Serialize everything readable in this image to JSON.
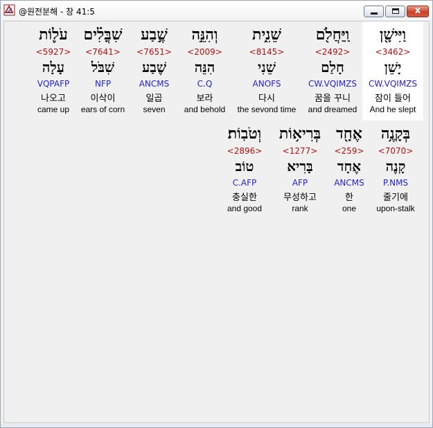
{
  "window": {
    "title": "@원전분해 - 창 41:5",
    "close_glyph": "x"
  },
  "row1": [
    {
      "heb": "וַיִּישָׁ֖ן",
      "strong": "<3462>",
      "lemma": "יָשֵׁן",
      "morph": "CW.VQIMZS",
      "kor": "잠이 들어",
      "eng": "And he slept",
      "highlight": true
    },
    {
      "heb": "וַֽיַּחֲלֹ֖ם",
      "strong": "<2492>",
      "lemma": "חָלַם",
      "morph": "CW.VQIMZS",
      "kor": "꿈을 꾸니",
      "eng": "and dreamed",
      "highlight": false
    },
    {
      "heb": "שֵׁנִ֑ית",
      "strong": "<8145>",
      "lemma": "שֵׁנִי",
      "morph": "ANOFS",
      "kor": "다시",
      "eng": "the sevond time",
      "highlight": false
    },
    {
      "heb": "וְהִנֵּ֣ה",
      "strong": "<2009>",
      "lemma": "הִנֵּה",
      "morph": "C.Q",
      "kor": "보라",
      "eng": "and behold",
      "highlight": false
    },
    {
      "heb": "שֶׁ֣בַע",
      "strong": "<7651>",
      "lemma": "שֶׁבַע",
      "morph": "ANCMS",
      "kor": "일곱",
      "eng": "seven",
      "highlight": false
    },
    {
      "heb": "שִׁבֳּלִ֗ים",
      "strong": "<7641>",
      "lemma": "שִׁבֹּל",
      "morph": "NFP",
      "kor": "이삭이",
      "eng": "ears of corn",
      "highlight": false
    },
    {
      "heb": "עֹל֛וֹת",
      "strong": "<5927>",
      "lemma": "עָלָה",
      "morph": "VQPAFP",
      "kor": "나오고",
      "eng": "came up",
      "highlight": false
    }
  ],
  "row2": [
    {
      "heb": "בְּקָנֶ֥ה",
      "strong": "<7070>",
      "lemma": "קָנֶה",
      "morph": "P.NMS",
      "kor": "줄기에",
      "eng": "upon-stalk",
      "highlight": false
    },
    {
      "heb": "אֶחָ֖ד",
      "strong": "<259>",
      "lemma": "אֶחָד",
      "morph": "ANCMS",
      "kor": "한",
      "eng": "one",
      "highlight": false
    },
    {
      "heb": "בְּרִיא֥וֹת",
      "strong": "<1277>",
      "lemma": "בָּרִיא",
      "morph": "AFP",
      "kor": "무성하고",
      "eng": "rank",
      "highlight": false
    },
    {
      "heb": "וְטֹבֽוֹת׃",
      "strong": "<2896>",
      "lemma": "טוֹב",
      "morph": "C.AFP",
      "kor": "충실한",
      "eng": "and good",
      "highlight": false
    }
  ]
}
